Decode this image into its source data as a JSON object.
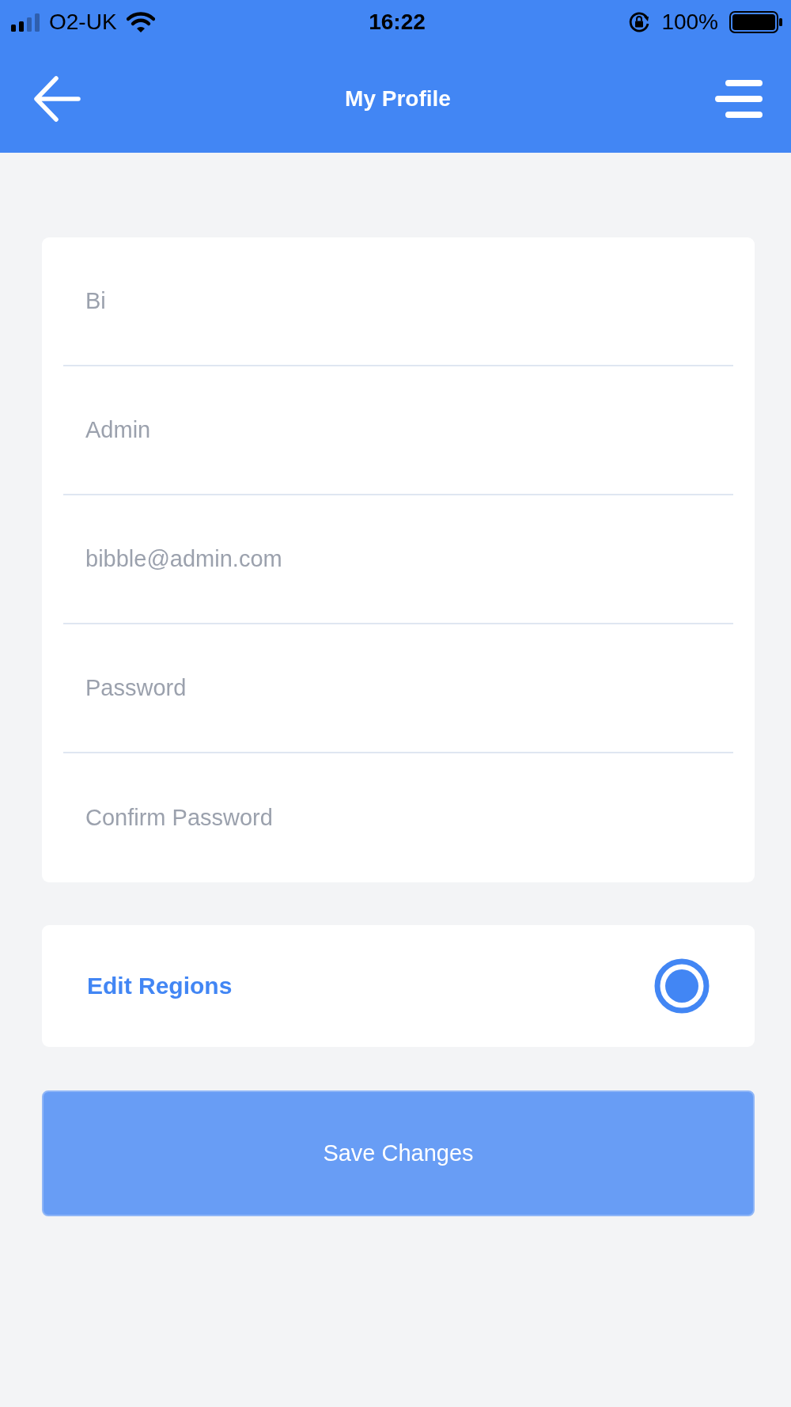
{
  "status_bar": {
    "carrier": "O2-UK",
    "time": "16:22",
    "battery": "100%"
  },
  "header": {
    "title": "My Profile"
  },
  "profile_form": {
    "fields": [
      {
        "value": "Bi"
      },
      {
        "value": "Admin"
      },
      {
        "value": "bibble@admin.com"
      },
      {
        "placeholder": "Password"
      },
      {
        "placeholder": "Confirm Password"
      }
    ]
  },
  "edit_regions": {
    "label": "Edit Regions",
    "checked": true
  },
  "save_button": {
    "label": "Save Changes",
    "disabled": true
  }
}
